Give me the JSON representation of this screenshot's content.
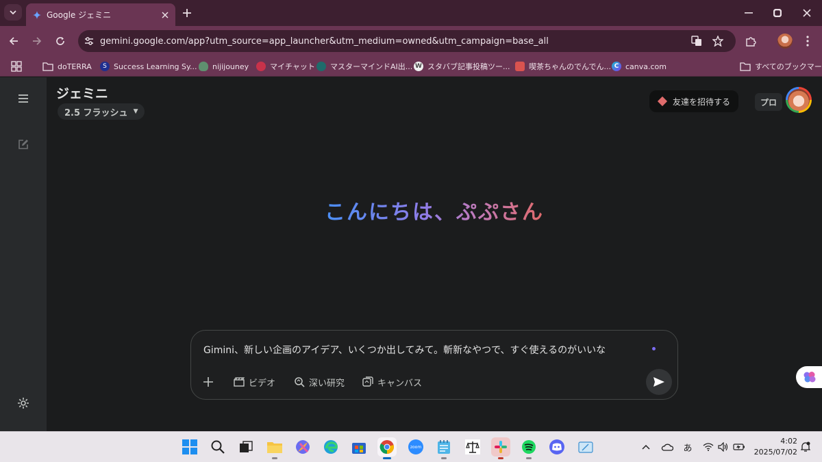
{
  "browser": {
    "tab_title": "Google ジェミニ",
    "url": "gemini.google.com/app?utm_source=app_launcher&utm_medium=owned&utm_campaign=base_all"
  },
  "bookmarks": {
    "items": [
      {
        "label": "doTERRA",
        "icon": "folder-icon"
      },
      {
        "label": "Success Learning Sy...",
        "icon": "s-logo-icon"
      },
      {
        "label": "nijijouney",
        "icon": "nijijourney-icon"
      },
      {
        "label": "マイチャット",
        "icon": "chat-icon"
      },
      {
        "label": "マスターマインドAI出...",
        "icon": "mastermind-icon"
      },
      {
        "label": "スタバブ記事投稿ツー...",
        "icon": "wordpress-icon"
      },
      {
        "label": "喫茶ちゃんのでんでん...",
        "icon": "cafe-icon"
      },
      {
        "label": "canva.com",
        "icon": "canva-icon"
      }
    ],
    "all_bookmarks": "すべてのブックマーク"
  },
  "app": {
    "title": "ジェミニ",
    "model": "2.5 フラッシュ",
    "invite_label": "友達を招待する",
    "pro_label": "プロ",
    "greeting": "こんにちは、ぷぷさん"
  },
  "composer": {
    "prompt_text": "Gimini、新しい企画のアイデア、いくつか出してみて。斬新なやつで、すぐ使えるのがいいな",
    "tools": {
      "video": "ビデオ",
      "deep_research": "深い研究",
      "canvas": "キャンバス"
    }
  },
  "taskbar": {
    "ime": "あ",
    "time": "4:02",
    "date": "2025/07/02"
  },
  "colors": {
    "accent_blue": "#4a8ff5",
    "accent_red": "#e06a6a",
    "browser_frame": "#6a3553"
  }
}
